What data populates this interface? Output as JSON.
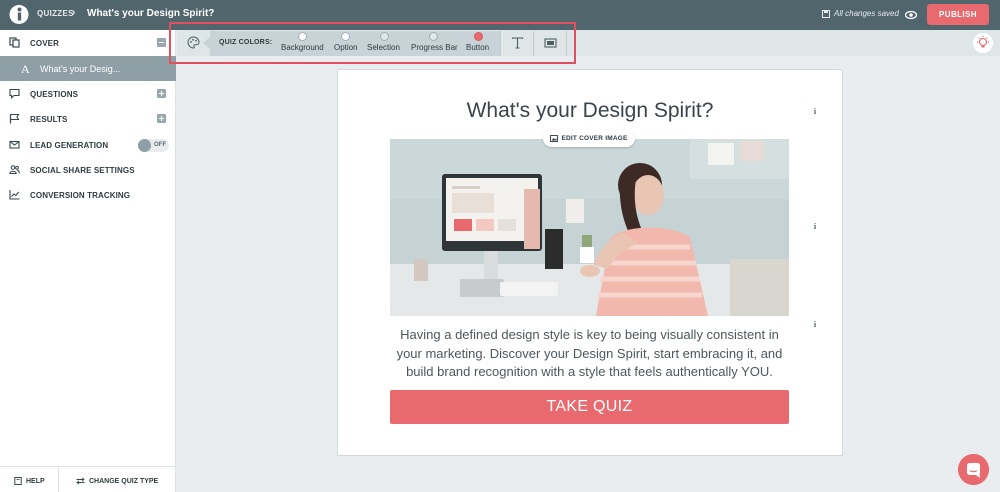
{
  "topbar": {
    "breadcrumb": "QUIZZES",
    "separator": "›",
    "quiz_title": "What's your Design Spirit?",
    "save_status": "All changes saved",
    "publish_label": "PUBLISH"
  },
  "sidebar": {
    "items": [
      {
        "label": "COVER",
        "icon": "copy-icon",
        "control": "collapse"
      },
      {
        "label": "QUESTIONS",
        "icon": "comment-icon",
        "control": "add"
      },
      {
        "label": "RESULTS",
        "icon": "flag-icon",
        "control": "add"
      },
      {
        "label": "LEAD GENERATION",
        "icon": "envelope-icon",
        "control": "toggle"
      },
      {
        "label": "SOCIAL SHARE SETTINGS",
        "icon": "users-icon"
      },
      {
        "label": "CONVERSION TRACKING",
        "icon": "chart-line-icon"
      }
    ],
    "cover_sub_item": {
      "glyph": "A",
      "label": "What's your Desig..."
    },
    "lead_toggle_label": "OFF",
    "footer": {
      "help_label": "HELP",
      "change_type_label": "CHANGE QUIZ TYPE"
    }
  },
  "toolbar": {
    "quiz_colors_label": "QUIZ COLORS:",
    "swatches": [
      {
        "label": "Background",
        "color": "#ffffff"
      },
      {
        "label": "Option",
        "color": "#ffffff"
      },
      {
        "label": "Selection",
        "color": "#dfe8ea"
      },
      {
        "label": "Progress Bar",
        "color": "#dfe8ea"
      },
      {
        "label": "Button",
        "color": "#e96a6e"
      }
    ],
    "tools": [
      "text-icon",
      "image-icon"
    ]
  },
  "cover": {
    "title": "What's your Design Spirit?",
    "edit_image_label": "EDIT COVER IMAGE",
    "description": "Having a defined design style is key to being visually consistent in your marketing. Discover your Design Spirit, start embracing it, and build brand recognition with a style that feels authentically YOU.",
    "button_label": "TAKE QUIZ"
  },
  "colors": {
    "topbar": "#51656c",
    "accent": "#e96a6e",
    "selected_item": "#8e9fa5"
  }
}
